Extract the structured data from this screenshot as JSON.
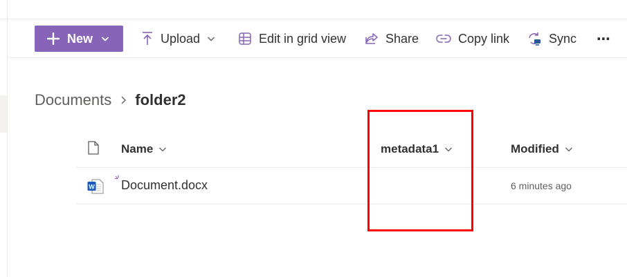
{
  "command_bar": {
    "new_label": "New",
    "upload_label": "Upload",
    "edit_grid_label": "Edit in grid view",
    "share_label": "Share",
    "copy_link_label": "Copy link",
    "sync_label": "Sync",
    "more_label": "⋯"
  },
  "breadcrumb": {
    "parent": "Documents",
    "current": "folder2"
  },
  "list": {
    "columns": {
      "name": "Name",
      "metadata1": "metadata1",
      "modified": "Modified"
    },
    "rows": [
      {
        "name": "Document.docx",
        "metadata1": "",
        "modified": "6 minutes ago"
      }
    ]
  },
  "colors": {
    "accent": "#8764b8",
    "highlight": "#ff0000",
    "word_blue": "#185abd"
  },
  "icons": {
    "new_plus": "plus-icon",
    "upload": "upload-icon",
    "grid": "grid-icon",
    "share": "share-icon",
    "link": "link-icon",
    "sync": "sync-icon",
    "file_header": "file-type-icon",
    "word": "word-doc-icon"
  }
}
